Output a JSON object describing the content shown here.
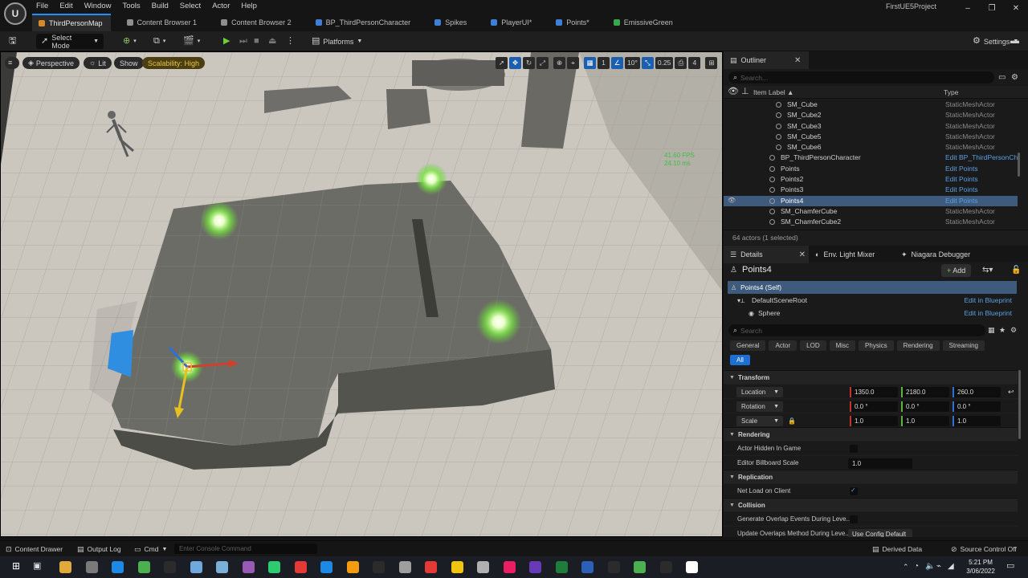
{
  "menu": [
    "File",
    "Edit",
    "Window",
    "Tools",
    "Build",
    "Select",
    "Actor",
    "Help"
  ],
  "project_name": "FirstUE5Project",
  "tabs": [
    {
      "label": "ThirdPersonMap",
      "color": "#d88a2a"
    },
    {
      "label": "Content Browser 1",
      "color": "#8f8f8f"
    },
    {
      "label": "Content Browser 2",
      "color": "#8f8f8f"
    },
    {
      "label": "BP_ThirdPersonCharacter",
      "color": "#3f7fd8"
    },
    {
      "label": "Spikes",
      "color": "#3f7fd8"
    },
    {
      "label": "PlayerUI*",
      "color": "#3f7fd8"
    },
    {
      "label": "Points*",
      "color": "#3f7fd8"
    },
    {
      "label": "EmissiveGreen",
      "color": "#37a84a"
    }
  ],
  "toolbar": {
    "select_mode": "Select Mode",
    "platforms": "Platforms",
    "settings": "Settings"
  },
  "viewport": {
    "perspective": "Perspective",
    "lit": "Lit",
    "show": "Show",
    "scalability": "Scalability: High",
    "fps": "41.60 FPS",
    "ms": "24.10 ms",
    "grid_snap": "1",
    "rotation_snap": "10°",
    "scale_snap": "0.25",
    "camera_speed": "4"
  },
  "outliner": {
    "tab": "Outliner",
    "search_placeholder": "Search...",
    "col_label": "Item Label ▲",
    "col_type": "Type",
    "rows": [
      {
        "label": "SM_Cube",
        "type": "StaticMeshActor",
        "indent": 2,
        "link": false
      },
      {
        "label": "SM_Cube2",
        "type": "StaticMeshActor",
        "indent": 2,
        "link": false
      },
      {
        "label": "SM_Cube3",
        "type": "StaticMeshActor",
        "indent": 2,
        "link": false
      },
      {
        "label": "SM_Cube5",
        "type": "StaticMeshActor",
        "indent": 2,
        "link": false
      },
      {
        "label": "SM_Cube6",
        "type": "StaticMeshActor",
        "indent": 2,
        "link": false
      },
      {
        "label": "BP_ThirdPersonCharacter",
        "type": "Edit BP_ThirdPersonCh",
        "indent": 1,
        "link": true
      },
      {
        "label": "Points",
        "type": "Edit Points",
        "indent": 1,
        "link": true
      },
      {
        "label": "Points2",
        "type": "Edit Points",
        "indent": 1,
        "link": true
      },
      {
        "label": "Points3",
        "type": "Edit Points",
        "indent": 1,
        "link": true
      },
      {
        "label": "Points4",
        "type": "Edit Points",
        "indent": 1,
        "link": true,
        "selected": true
      },
      {
        "label": "SM_ChamferCube",
        "type": "StaticMeshActor",
        "indent": 1,
        "link": false
      },
      {
        "label": "SM_ChamferCube2",
        "type": "StaticMeshActor",
        "indent": 1,
        "link": false
      }
    ],
    "status": "64 actors (1 selected)"
  },
  "details": {
    "tabs": [
      "Details",
      "Env. Light Mixer",
      "Niagara Debugger"
    ],
    "actor_name": "Points4",
    "add_label": "Add",
    "components": [
      {
        "label": "Points4 (Self)",
        "link": "",
        "selected": true
      },
      {
        "label": "DefaultSceneRoot",
        "link": "Edit in Blueprint"
      },
      {
        "label": "Sphere",
        "link": "Edit in Blueprint"
      }
    ],
    "search_placeholder": "Search",
    "categories": [
      "General",
      "Actor",
      "LOD",
      "Misc",
      "Physics",
      "Rendering",
      "Streaming"
    ],
    "all_label": "All",
    "transform": {
      "title": "Transform",
      "location_label": "Location",
      "location": [
        "1350.0",
        "2180.0",
        "260.0"
      ],
      "rotation_label": "Rotation",
      "rotation": [
        "0.0 °",
        "0.0 °",
        "0.0 °"
      ],
      "scale_label": "Scale",
      "scale": [
        "1.0",
        "1.0",
        "1.0"
      ]
    },
    "rendering": {
      "title": "Rendering",
      "hidden_label": "Actor Hidden In Game",
      "billboard_label": "Editor Billboard Scale",
      "billboard_value": "1.0"
    },
    "replication": {
      "title": "Replication",
      "net_load_label": "Net Load on Client",
      "net_load": true
    },
    "collision": {
      "title": "Collision",
      "overlap_label": "Generate Overlap Events During Leve...",
      "update_label": "Update Overlaps Method During Leve...",
      "update_value": "Use Config Default"
    }
  },
  "statusbar": {
    "content_drawer": "Content Drawer",
    "output_log": "Output Log",
    "cmd": "Cmd",
    "console_placeholder": "Enter Console Command",
    "derived_data": "Derived Data",
    "source_control": "Source Control Off"
  },
  "taskbar": {
    "time": "5:21 PM",
    "date": "3/06/2022",
    "app_colors": [
      "#e0a93a",
      "#7a7a7a",
      "#1e88e5",
      "#4caf50",
      "#2b2b2b",
      "#6fa8dc",
      "#7ab0d8",
      "#9b59b6",
      "#2ecc71",
      "#e53935",
      "#1e88e5",
      "#f39c12",
      "#2b2b2b",
      "#9e9e9e",
      "#e53935",
      "#f1c40f",
      "#b0b0b0",
      "#e91e63",
      "#673ab7",
      "#1f7d3b",
      "#2b5fb8",
      "#2b2b2b",
      "#4caf50",
      "#2b2b2b",
      "#ffffff"
    ]
  }
}
